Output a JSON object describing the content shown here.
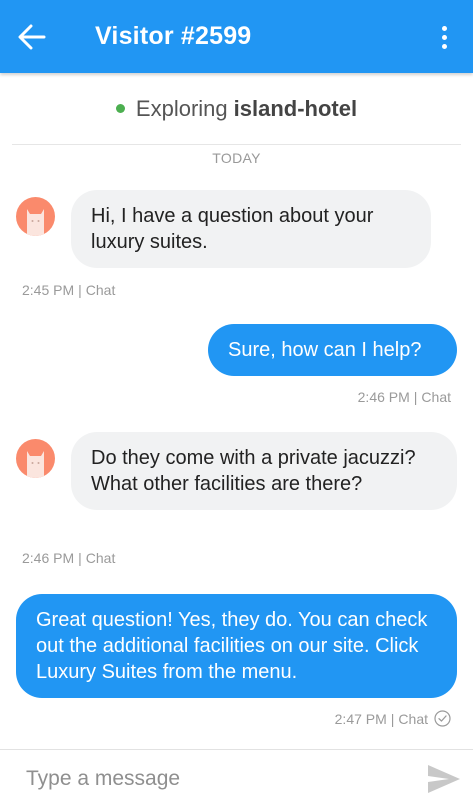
{
  "header": {
    "back_icon": "arrow-left-icon",
    "title": "Visitor #2599",
    "menu_icon": "more-vertical-icon",
    "color": "#2196f3"
  },
  "status": {
    "online_color": "#4caf50",
    "prefix": "Exploring",
    "site": "island-hotel"
  },
  "day_label": "TODAY",
  "messages": [
    {
      "from": "visitor",
      "text": "Hi, I have a question about your luxury suites.",
      "time": "2:45 PM",
      "channel": "Chat"
    },
    {
      "from": "agent",
      "text": "Sure, how can I help?",
      "time": "2:46 PM",
      "channel": "Chat"
    },
    {
      "from": "visitor",
      "text": "Do they come with a private jacuzzi? What other facilities are there?",
      "time": "2:46 PM",
      "channel": "Chat"
    },
    {
      "from": "agent",
      "text": "Great question! Yes, they do. You can check out the additional facilities on our site. Click Luxury Suites from the menu.",
      "time": "2:47 PM",
      "channel": "Chat",
      "status_icon": "check-circle-icon"
    }
  ],
  "composer": {
    "placeholder": "Type a message",
    "send_icon": "send-icon"
  },
  "colors": {
    "agent_bubble": "#2196f3",
    "visitor_bubble": "#f1f2f3",
    "avatar": "#fa8a6c"
  }
}
